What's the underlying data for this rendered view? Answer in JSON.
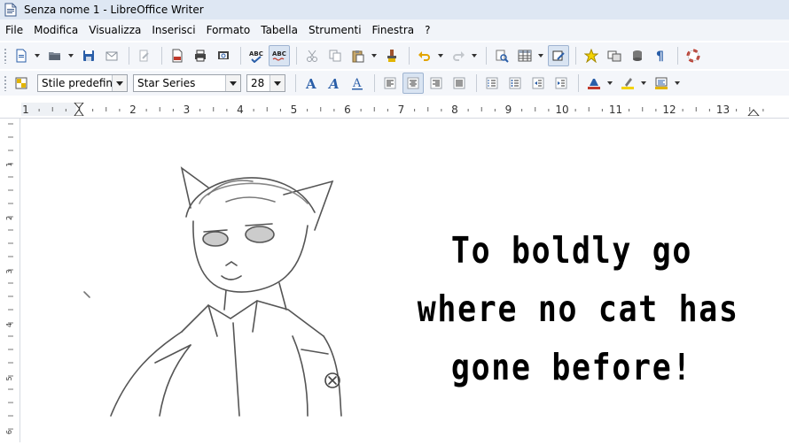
{
  "window": {
    "title": "Senza nome 1 - LibreOffice Writer"
  },
  "menubar": {
    "items": [
      {
        "label": "File"
      },
      {
        "label": "Modifica"
      },
      {
        "label": "Visualizza"
      },
      {
        "label": "Inserisci"
      },
      {
        "label": "Formato"
      },
      {
        "label": "Tabella"
      },
      {
        "label": "Strumenti"
      },
      {
        "label": "Finestra"
      },
      {
        "label": "?"
      }
    ]
  },
  "formatting": {
    "paragraph_style": "Stile predefinito",
    "font_name": "Star Series",
    "font_size": "28"
  },
  "ruler": {
    "ticks": [
      "1",
      "1",
      "2",
      "3",
      "4",
      "5",
      "6",
      "7",
      "8",
      "9",
      "10",
      "11",
      "12",
      "13"
    ],
    "vticks": [
      "1",
      "2",
      "3",
      "4",
      "5",
      "6"
    ]
  },
  "document": {
    "lines": [
      "To boldly go",
      "where no cat has",
      "gone before!"
    ]
  },
  "colors": {
    "titlebar": "#dee7f3",
    "toolbar": "#f4f6fa",
    "accent": "#2a5ea8",
    "highlight": "#f4d300",
    "font_color": "#c0392b"
  }
}
